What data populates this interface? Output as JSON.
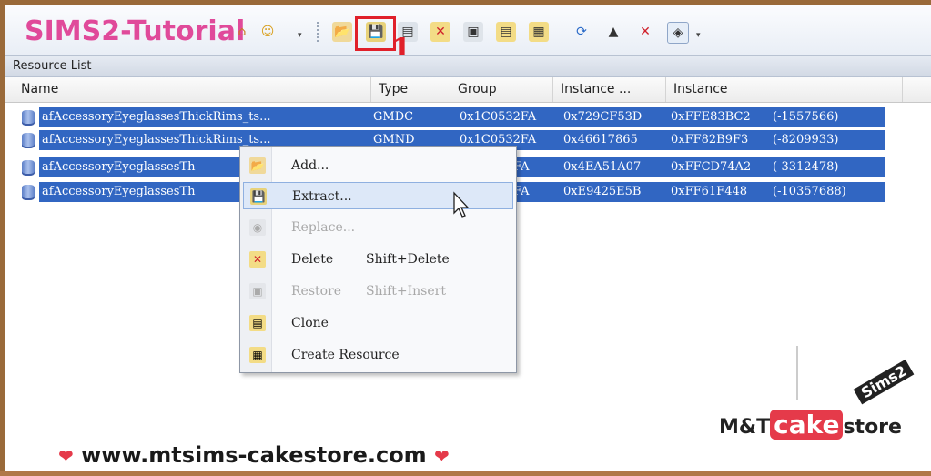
{
  "toolbar": {
    "title": "SIMS2-Tutorial",
    "annotation_number": "1",
    "icons": [
      "folder-open-icon",
      "save-icon",
      "notes-icon",
      "delete-icon",
      "restore-icon",
      "clone-icon",
      "new-resource-icon",
      "sync-icon",
      "hat-icon",
      "pin-icon",
      "preview-icon"
    ]
  },
  "panel": {
    "title": "Resource List"
  },
  "columns": [
    "Name",
    "Type",
    "Group",
    "Instance ...",
    "Instance"
  ],
  "rows": [
    {
      "name": "afAccessoryEyeglassesThickRims_ts...",
      "type": "GMDC",
      "group": "0x1C0532FA",
      "instance_hi": "0x729CF53D",
      "instance": "0xFFE83BC2",
      "instance_dec": "(-1557566)"
    },
    {
      "name": "afAccessoryEyeglassesThickRims_ts...",
      "type": "GMND",
      "group": "0x1C0532FA",
      "instance_hi": "0x46617865",
      "instance": "0xFF82B9F3",
      "instance_dec": "(-8209933)"
    },
    {
      "name": "afAccessoryEyeglassesTh",
      "type": "",
      "group": "2FA",
      "instance_hi": "0x4EA51A07",
      "instance": "0xFFCD74A2",
      "instance_dec": "(-3312478)"
    },
    {
      "name": "afAccessoryEyeglassesTh",
      "type": "",
      "group": "2FA",
      "instance_hi": "0xE9425E5B",
      "instance": "0xFF61F448",
      "instance_dec": "(-10357688)"
    }
  ],
  "context_menu": {
    "items": [
      {
        "label": "Add...",
        "shortcut": "",
        "icon": "folder-add-icon",
        "enabled": true,
        "highlighted": false
      },
      {
        "label": "Extract...",
        "shortcut": "",
        "icon": "extract-save-icon",
        "enabled": true,
        "highlighted": true
      },
      {
        "label": "Replace...",
        "shortcut": "",
        "icon": "replace-icon",
        "enabled": false,
        "highlighted": false
      },
      {
        "label": "Delete",
        "shortcut": "Shift+Delete",
        "icon": "delete-icon",
        "enabled": true,
        "highlighted": false
      },
      {
        "label": "Restore",
        "shortcut": "Shift+Insert",
        "icon": "restore-icon",
        "enabled": false,
        "highlighted": false
      },
      {
        "label": "Clone",
        "shortcut": "",
        "icon": "clone-icon",
        "enabled": true,
        "highlighted": false
      },
      {
        "label": "Create Resource",
        "shortcut": "",
        "icon": "create-resource-icon",
        "enabled": true,
        "highlighted": false
      }
    ]
  },
  "footer": {
    "url": "www.mtsims-cakestore.com"
  },
  "logo": {
    "brand_left": "M&T",
    "brand_cake": "cake",
    "brand_right": "store",
    "tag": "Sims2"
  },
  "colors": {
    "selection": "#3166c2",
    "accent": "#e04a9a",
    "annotation": "#e0202a"
  }
}
